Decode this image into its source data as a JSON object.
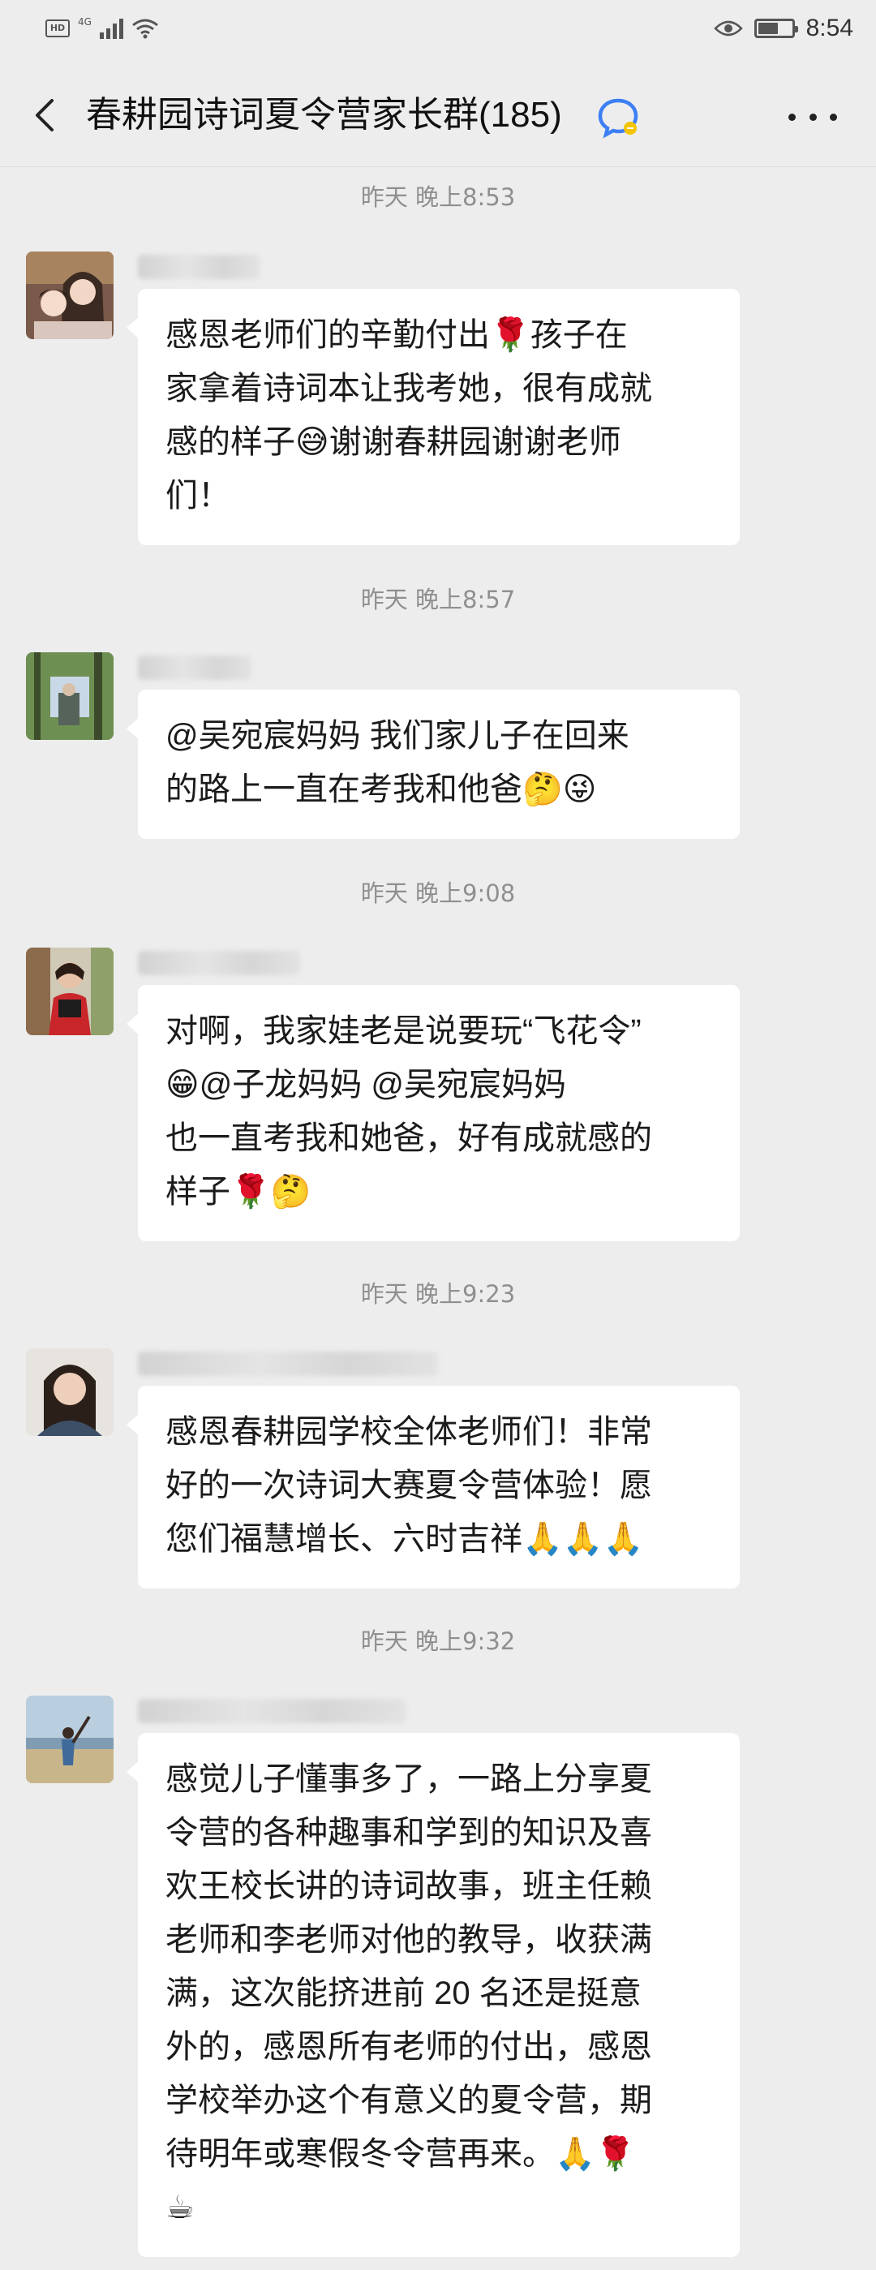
{
  "status_bar": {
    "hd_label": "HD",
    "network_label": "4G",
    "time": "8:54",
    "battery_level": 0.6
  },
  "header": {
    "title": "春耕园诗词夏令营家长群(185)",
    "back_icon": "chevron-left-icon",
    "mute_icon": "chat-mute-icon",
    "more_icon": "more-dots-icon"
  },
  "messages": [
    {
      "timestamp": "昨天 晚上8:53",
      "lines": [
        "感恩老师们的辛勤付出🌹孩子在",
        "家拿着诗词本让我考她，很有成就",
        "感的样子😅谢谢春耕园谢谢老师",
        "们！"
      ]
    },
    {
      "timestamp": "昨天 晚上8:57",
      "lines": [
        "@吴宛宸妈妈  我们家儿子在回来",
        "的路上一直在考我和他爸🤔😜"
      ]
    },
    {
      "timestamp": "昨天 晚上9:08",
      "lines": [
        "对啊，我家娃老是说要玩“飞花令”",
        "😁@子龙妈妈  @吴宛宸妈妈",
        "也一直考我和她爸，好有成就感的",
        "样子🌹🤔"
      ]
    },
    {
      "timestamp": "昨天 晚上9:23",
      "lines": [
        "感恩春耕园学校全体老师们！非常",
        "好的一次诗词大赛夏令营体验！愿",
        "您们福慧增长、六时吉祥🙏🙏🙏"
      ]
    },
    {
      "timestamp": "昨天 晚上9:32",
      "lines": [
        "感觉儿子懂事多了，一路上分享夏",
        "令营的各种趣事和学到的知识及喜",
        "欢王校长讲的诗词故事，班主任赖",
        "老师和李老师对他的教导，收获满",
        "满，这次能挤进前 20 名还是挺意",
        "外的，感恩所有老师的付出，感恩",
        "学校举办这个有意义的夏令营，期",
        "待明年或寒假冬令营再来。🙏🌹",
        "☕"
      ]
    }
  ],
  "colors": {
    "background": "#ededed",
    "bubble": "#ffffff",
    "timestamp_text": "#8f8f8f",
    "mute_icon_blue": "#3d7ff5",
    "mute_icon_yellow": "#f5c400"
  }
}
